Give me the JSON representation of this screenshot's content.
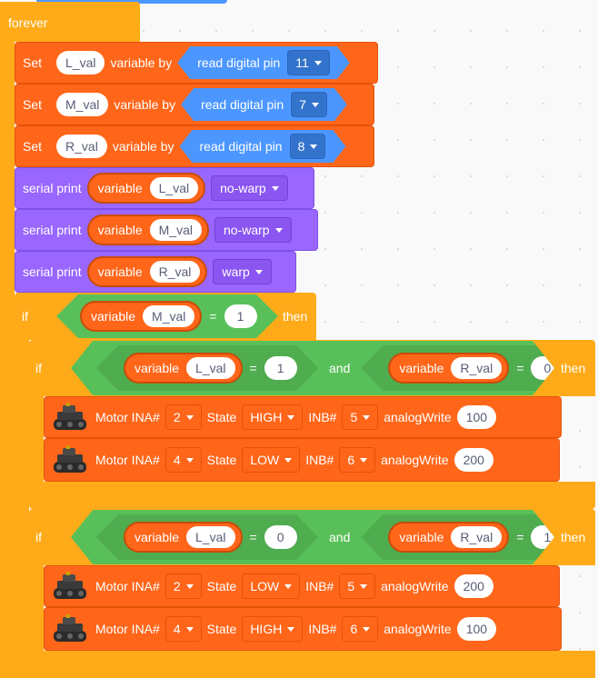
{
  "forever": {
    "label": "forever"
  },
  "set_blocks": [
    {
      "set": "Set",
      "var": "L_val",
      "by": "variable by",
      "read": "read digital pin",
      "pin": "11"
    },
    {
      "set": "Set",
      "var": "M_val",
      "by": "variable by",
      "read": "read digital pin",
      "pin": "7"
    },
    {
      "set": "Set",
      "var": "R_val",
      "by": "variable by",
      "read": "read digital pin",
      "pin": "8"
    }
  ],
  "serial_blocks": [
    {
      "label": "serial print",
      "variable": "variable",
      "var": "L_val",
      "mode": "no-warp"
    },
    {
      "label": "serial print",
      "variable": "variable",
      "var": "M_val",
      "mode": "no-warp"
    },
    {
      "label": "serial print",
      "variable": "variable",
      "var": "R_val",
      "mode": "warp"
    }
  ],
  "if_main": {
    "if": "if",
    "variable": "variable",
    "var": "M_val",
    "eq": "=",
    "value": "1",
    "then": "then"
  },
  "if_inner_1": {
    "if": "if",
    "left": {
      "variable": "variable",
      "var": "L_val",
      "eq": "=",
      "value": "1"
    },
    "and": "and",
    "right": {
      "variable": "variable",
      "var": "R_val",
      "eq": "=",
      "value": "0"
    },
    "then": "then",
    "motors": [
      {
        "motor": "Motor INA#",
        "ina": "2",
        "state_label": "State",
        "state": "HIGH",
        "inb_label": "INB#",
        "inb": "5",
        "aw": "analogWrite",
        "aw_val": "100"
      },
      {
        "motor": "Motor INA#",
        "ina": "4",
        "state_label": "State",
        "state": "LOW",
        "inb_label": "INB#",
        "inb": "6",
        "aw": "analogWrite",
        "aw_val": "200"
      }
    ]
  },
  "if_inner_2": {
    "if": "if",
    "left": {
      "variable": "variable",
      "var": "L_val",
      "eq": "=",
      "value": "0"
    },
    "and": "and",
    "right": {
      "variable": "variable",
      "var": "R_val",
      "eq": "=",
      "value": "1"
    },
    "then": "then",
    "motors": [
      {
        "motor": "Motor INA#",
        "ina": "2",
        "state_label": "State",
        "state": "LOW",
        "inb_label": "INB#",
        "inb": "5",
        "aw": "analogWrite",
        "aw_val": "200"
      },
      {
        "motor": "Motor INA#",
        "ina": "4",
        "state_label": "State",
        "state": "HIGH",
        "inb_label": "INB#",
        "inb": "6",
        "aw": "analogWrite",
        "aw_val": "100"
      }
    ]
  },
  "colors": {
    "control": "#ffab19",
    "variable": "#ff661a",
    "sensing": "#4c97ff",
    "serial": "#9966ff",
    "operator": "#59c059"
  }
}
